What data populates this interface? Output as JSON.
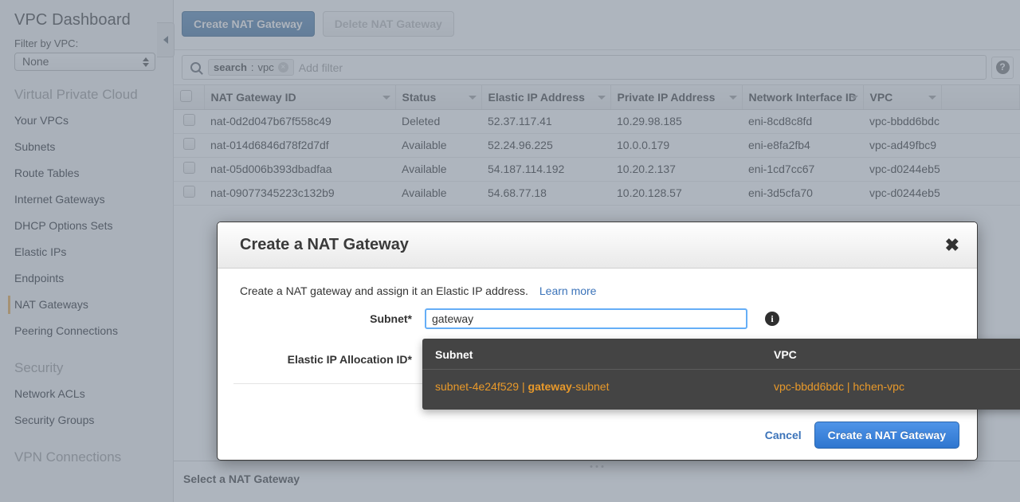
{
  "sidebar": {
    "title": "VPC Dashboard",
    "filter_label": "Filter by VPC:",
    "filter_value": "None",
    "groups": [
      {
        "title": "Virtual Private Cloud",
        "items": [
          {
            "label": "Your VPCs",
            "active": false
          },
          {
            "label": "Subnets",
            "active": false
          },
          {
            "label": "Route Tables",
            "active": false
          },
          {
            "label": "Internet Gateways",
            "active": false
          },
          {
            "label": "DHCP Options Sets",
            "active": false
          },
          {
            "label": "Elastic IPs",
            "active": false
          },
          {
            "label": "Endpoints",
            "active": false
          },
          {
            "label": "NAT Gateways",
            "active": true
          },
          {
            "label": "Peering Connections",
            "active": false
          }
        ]
      },
      {
        "title": "Security",
        "items": [
          {
            "label": "Network ACLs",
            "active": false
          },
          {
            "label": "Security Groups",
            "active": false
          }
        ]
      },
      {
        "title": "VPN Connections",
        "items": []
      }
    ]
  },
  "toolbar": {
    "create_label": "Create NAT Gateway",
    "delete_label": "Delete NAT Gateway"
  },
  "search": {
    "chip_key": "search",
    "chip_sep": " : ",
    "chip_value": "vpc",
    "chip_remove": "×",
    "placeholder": "Add filter",
    "help_glyph": "?"
  },
  "table": {
    "columns": [
      "NAT Gateway ID",
      "Status",
      "Elastic IP Address",
      "Private IP Address",
      "Network Interface ID",
      "VPC"
    ],
    "rows": [
      {
        "nat_gateway_id": "nat-0d2d047b67f558c49",
        "status": "Deleted",
        "status_kind": "deleted",
        "elastic_ip": "52.37.117.41",
        "private_ip": "10.29.98.185",
        "eni": "eni-8cd8c8fd",
        "vpc": "vpc-bbdd6bdc"
      },
      {
        "nat_gateway_id": "nat-014d6846d78f2d7df",
        "status": "Available",
        "status_kind": "available",
        "elastic_ip": "52.24.96.225",
        "private_ip": "10.0.0.179",
        "eni": "eni-e8fa2fb4",
        "vpc": "vpc-ad49fbc9"
      },
      {
        "nat_gateway_id": "nat-05d006b393dbadfaa",
        "status": "Available",
        "status_kind": "available",
        "elastic_ip": "54.187.114.192",
        "private_ip": "10.20.2.137",
        "eni": "eni-1cd7cc67",
        "vpc": "vpc-d0244eb5"
      },
      {
        "nat_gateway_id": "nat-09077345223c132b9",
        "status": "Available",
        "status_kind": "available",
        "elastic_ip": "54.68.77.18",
        "private_ip": "10.20.128.57",
        "eni": "eni-3d5cfa70",
        "vpc": "vpc-d0244eb5"
      }
    ]
  },
  "bottom_panel": {
    "title": "Select a NAT Gateway"
  },
  "modal": {
    "title": "Create a NAT Gateway",
    "close_glyph": "✖",
    "intro": "Create a NAT gateway and assign it an Elastic IP address.",
    "learn_more": "Learn more",
    "subnet_label": "Subnet*",
    "subnet_value": "gateway",
    "info_glyph": "i",
    "eip_label": "Elastic IP Allocation ID*",
    "cancel_label": "Cancel",
    "submit_label": "Create a NAT Gateway"
  },
  "autocomplete": {
    "col_subnet": "Subnet",
    "col_vpc": "VPC",
    "rows": [
      {
        "subnet_prefix": "subnet-4e24f529 | ",
        "subnet_match": "gateway",
        "subnet_suffix": "-subnet",
        "vpc": "vpc-bbdd6bdc | hchen-vpc"
      }
    ]
  },
  "colors": {
    "accent_blue": "#3d6f9f",
    "primary_blue": "#2f76cf",
    "link_blue": "#3b73b9",
    "status_deleted": "#d13212",
    "status_available": "#1d8102",
    "highlight_orange": "#e8992a",
    "nav_active": "#e8a33d"
  }
}
